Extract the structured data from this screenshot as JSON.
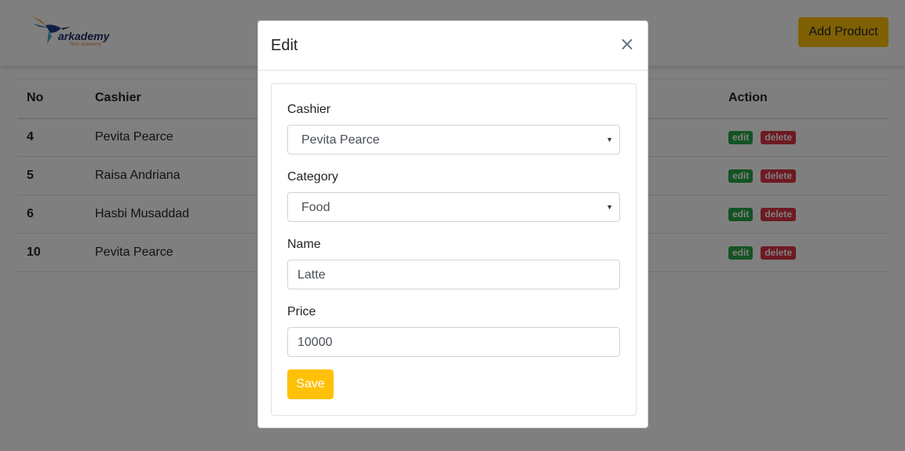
{
  "navbar": {
    "logo_text": "arkademy",
    "logo_subtext": "Tech Academy",
    "add_button_label": "Add Product"
  },
  "table": {
    "headers": [
      "No",
      "Cashier",
      "Action"
    ],
    "rows": [
      {
        "no": "4",
        "cashier": "Pevita Pearce",
        "partial": "0"
      },
      {
        "no": "5",
        "cashier": "Raisa Andriana",
        "partial": "0"
      },
      {
        "no": "6",
        "cashier": "Hasbi Musaddad",
        "partial": "0"
      },
      {
        "no": "10",
        "cashier": "Pevita Pearce",
        "partial": ""
      }
    ],
    "edit_label": "edit",
    "delete_label": "delete"
  },
  "modal": {
    "title": "Edit",
    "close_glyph": "×",
    "cashier_label": "Cashier",
    "cashier_value": "Pevita Pearce",
    "category_label": "Category",
    "category_value": "Food",
    "name_label": "Name",
    "name_value": "Latte",
    "price_label": "Price",
    "price_value": "10000",
    "save_label": "Save"
  },
  "colors": {
    "accent": "#ffc107",
    "edit_badge": "#28a745",
    "delete_badge": "#dc3545"
  }
}
